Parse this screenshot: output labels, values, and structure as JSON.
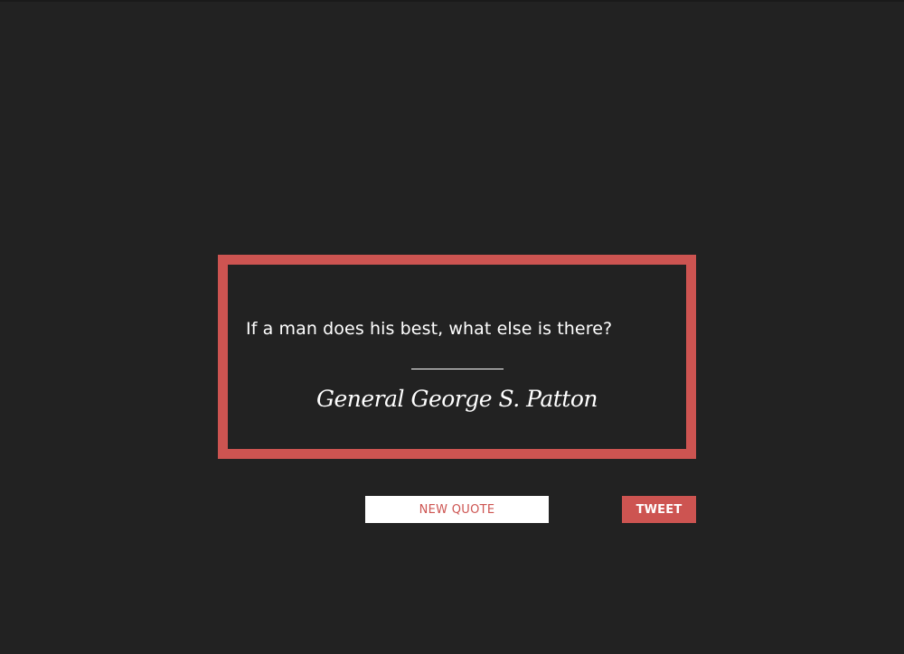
{
  "quote": {
    "text": "If a man does his best, what else is there?",
    "author": "General George S. Patton"
  },
  "buttons": {
    "new_quote_label": "NEW QUOTE",
    "tweet_label": "TWEET"
  },
  "colors": {
    "background": "#222222",
    "accent": "#cd5451",
    "text": "#ffffff",
    "button_light": "#ffffff"
  }
}
